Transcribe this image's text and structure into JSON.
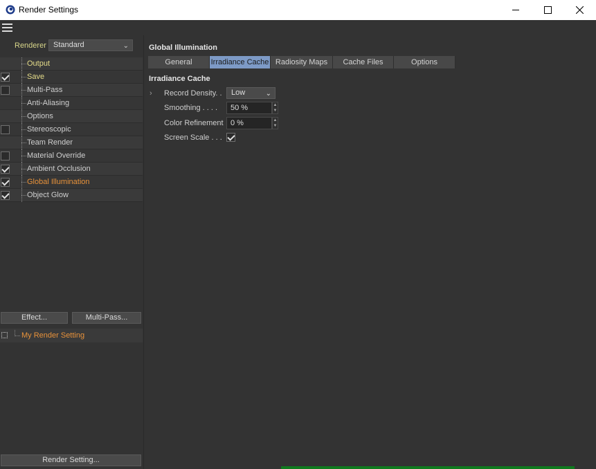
{
  "window": {
    "title": "Render Settings",
    "controls": {
      "minimize": "minimize-icon",
      "maximize": "maximize-icon",
      "close": "close-icon"
    }
  },
  "menu": {
    "icon": "hamburger-menu-icon"
  },
  "left": {
    "renderer_label": "Renderer",
    "renderer_value": "Standard",
    "items": [
      {
        "label": "Output",
        "checkbox": false,
        "checked": false,
        "style": "highlight"
      },
      {
        "label": "Save",
        "checkbox": true,
        "checked": true,
        "style": "highlight"
      },
      {
        "label": "Multi-Pass",
        "checkbox": true,
        "checked": false,
        "style": "normal"
      },
      {
        "label": "Anti-Aliasing",
        "checkbox": false,
        "checked": false,
        "style": "normal"
      },
      {
        "label": "Options",
        "checkbox": false,
        "checked": false,
        "style": "normal"
      },
      {
        "label": "Stereoscopic",
        "checkbox": true,
        "checked": false,
        "style": "normal"
      },
      {
        "label": "Team Render",
        "checkbox": false,
        "checked": false,
        "style": "normal"
      },
      {
        "label": "Material Override",
        "checkbox": true,
        "checked": false,
        "style": "normal"
      },
      {
        "label": "Ambient Occlusion",
        "checkbox": true,
        "checked": true,
        "style": "normal"
      },
      {
        "label": "Global Illumination",
        "checkbox": true,
        "checked": true,
        "style": "active"
      },
      {
        "label": "Object Glow",
        "checkbox": true,
        "checked": true,
        "style": "normal"
      }
    ],
    "effect_button": "Effect...",
    "multipass_button": "Multi-Pass...",
    "setting_name": "My Render Setting",
    "render_setting_button": "Render Setting..."
  },
  "right": {
    "section_title": "Global Illumination",
    "tabs": [
      {
        "label": "General",
        "active": false
      },
      {
        "label": "Irradiance Cache",
        "active": true
      },
      {
        "label": "Radiosity Maps",
        "active": false
      },
      {
        "label": "Cache Files",
        "active": false
      },
      {
        "label": "Options",
        "active": false
      }
    ],
    "subsection_title": "Irradiance Cache",
    "params": {
      "record_density_label": "Record Density. .",
      "record_density_value": "Low",
      "smoothing_label": "Smoothing . . . .",
      "smoothing_value": "50 %",
      "color_refinement_label": "Color Refinement",
      "color_refinement_value": "0 %",
      "screen_scale_label": "Screen Scale . . .",
      "screen_scale_checked": true
    }
  },
  "colors": {
    "panel_bg": "#333333",
    "active_tab": "#7d9ac6",
    "active_item": "#e8923a",
    "highlight_item": "#e6dd8a"
  }
}
